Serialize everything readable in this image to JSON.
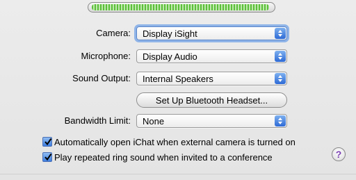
{
  "audio_meter": {
    "level": 0.99
  },
  "rows": {
    "camera": {
      "label": "Camera:",
      "value": "Display iSight"
    },
    "microphone": {
      "label": "Microphone:",
      "value": "Display Audio"
    },
    "sound_output": {
      "label": "Sound Output:",
      "value": "Internal Speakers"
    },
    "bandwidth": {
      "label": "Bandwidth Limit:",
      "value": "None"
    }
  },
  "bluetooth_button": {
    "label": "Set Up Bluetooth Headset..."
  },
  "checkboxes": [
    {
      "label": "Automatically open iChat when external camera is turned on",
      "checked": true
    },
    {
      "label": "Play repeated ring sound when invited to a conference",
      "checked": true
    }
  ],
  "help": {
    "glyph": "?"
  },
  "colors": {
    "accent": "#3e7ee0",
    "meter_green": "#5bbf3a",
    "help_purple": "#7a3fb3"
  }
}
